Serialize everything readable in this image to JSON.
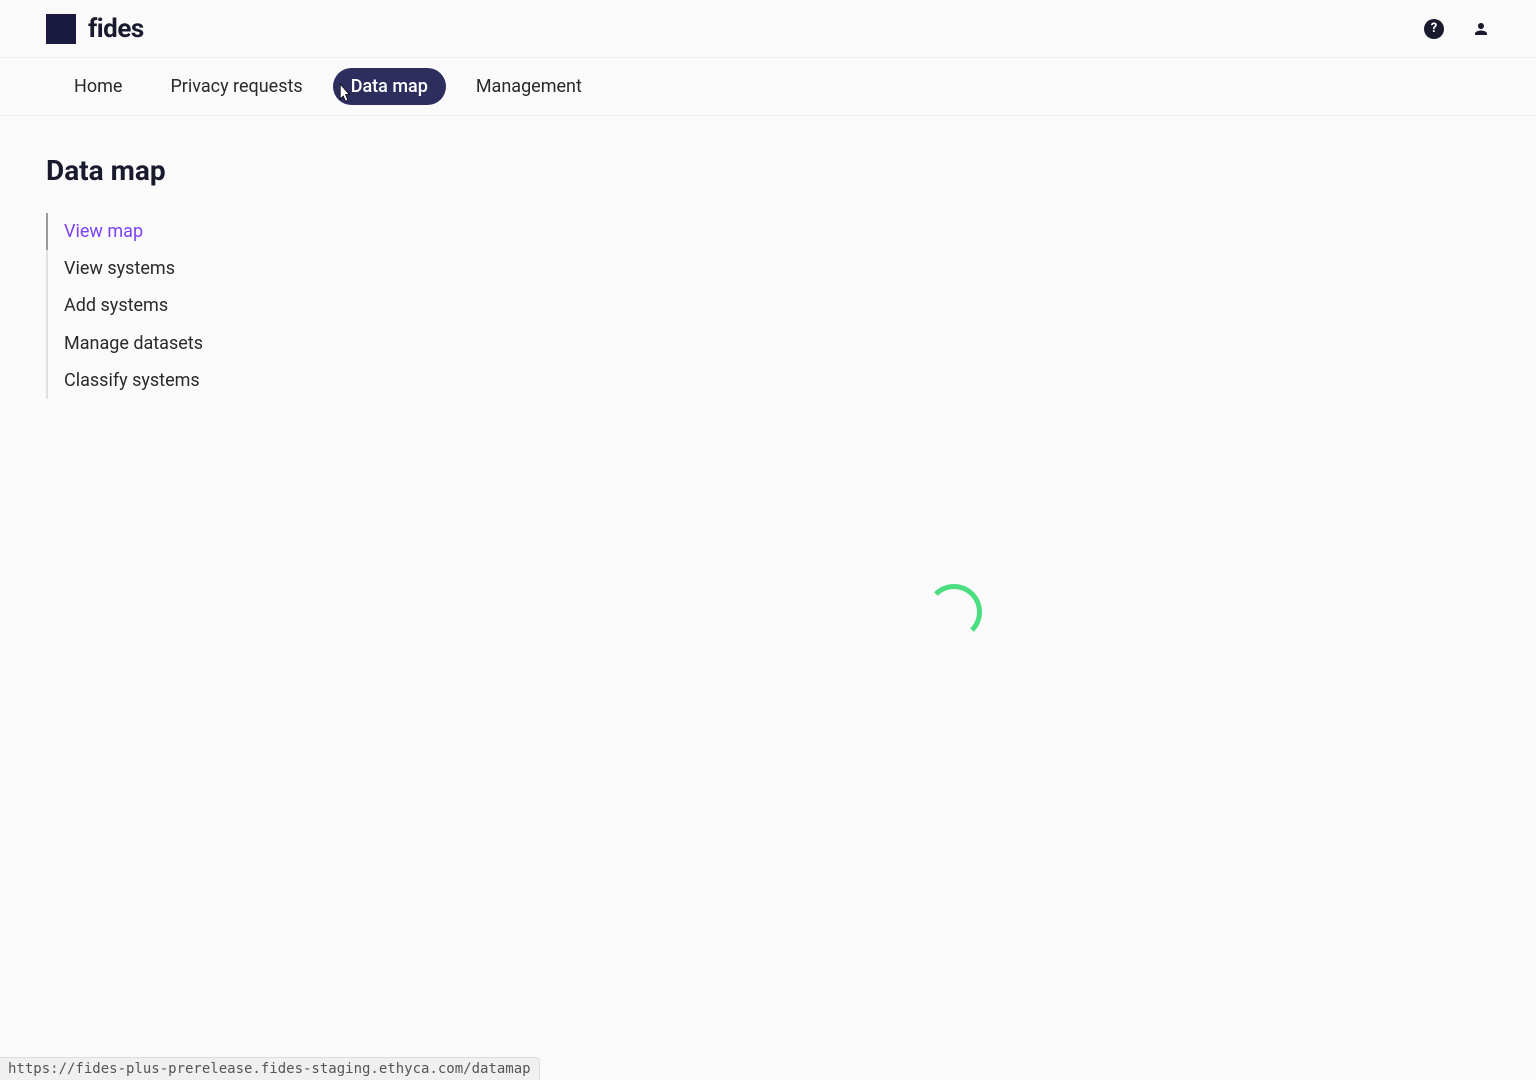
{
  "header": {
    "logo_text": "fides"
  },
  "nav": {
    "items": [
      {
        "label": "Home",
        "active": false
      },
      {
        "label": "Privacy requests",
        "active": false
      },
      {
        "label": "Data map",
        "active": true
      },
      {
        "label": "Management",
        "active": false
      }
    ]
  },
  "page": {
    "title": "Data map"
  },
  "sidebar": {
    "items": [
      {
        "label": "View map",
        "active": true
      },
      {
        "label": "View systems",
        "active": false
      },
      {
        "label": "Add systems",
        "active": false
      },
      {
        "label": "Manage datasets",
        "active": false
      },
      {
        "label": "Classify systems",
        "active": false
      }
    ]
  },
  "status_bar": {
    "url": "https://fides-plus-prerelease.fides-staging.ethyca.com/datamap"
  }
}
